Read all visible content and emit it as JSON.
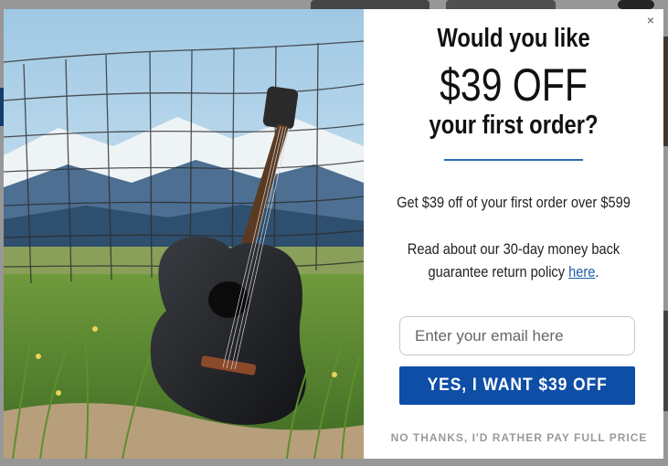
{
  "popup": {
    "heading_line1": "Would you like",
    "heading_price": "$39 OFF",
    "heading_line3": "your first order?",
    "offer_text": "Get $39 off of your first order over $599",
    "policy_text": "Read about our 30-day money back guarantee return policy",
    "policy_link": "here",
    "policy_end": ".",
    "email_placeholder": "Enter your email here",
    "cta_label": "YES, I WANT $39 OFF",
    "decline_label": "NO THANKS, I'D RATHER PAY FULL PRICE",
    "close_icon": "close-icon",
    "hero_image": "guitar-in-grass-fence-image"
  },
  "colors": {
    "accent": "#0e4ea6",
    "link": "#1f5da8",
    "divider": "#2b6cb5",
    "decline": "#9a9a9a"
  }
}
